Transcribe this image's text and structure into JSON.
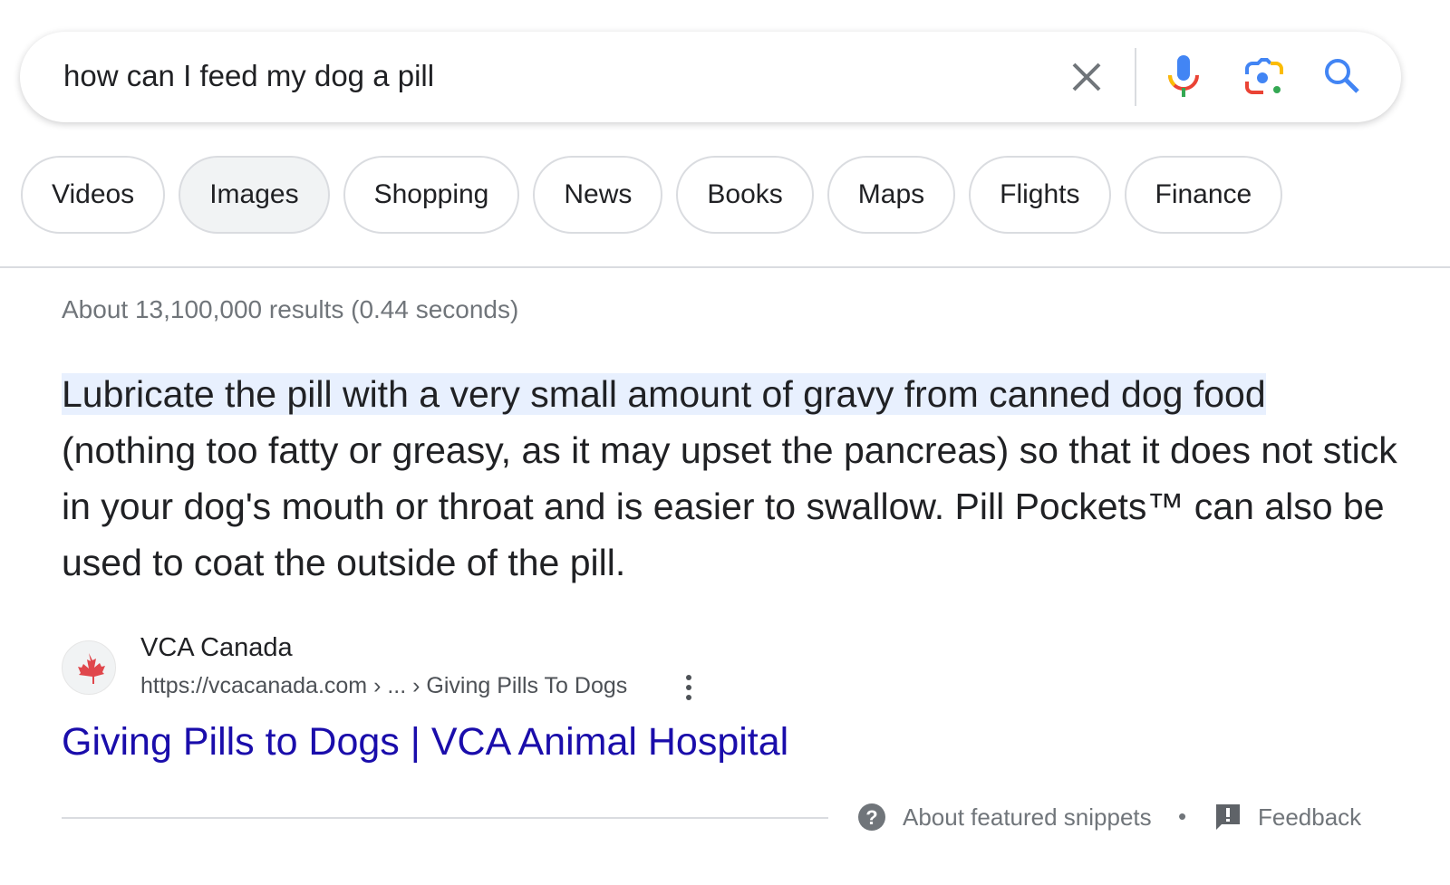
{
  "search": {
    "query": "how can I feed my dog a pill",
    "icons": [
      "close-icon",
      "microphone-icon",
      "lens-camera-icon",
      "search-icon"
    ]
  },
  "chips": [
    {
      "label": "Videos"
    },
    {
      "label": "Images",
      "active": true
    },
    {
      "label": "Shopping"
    },
    {
      "label": "News"
    },
    {
      "label": "Books"
    },
    {
      "label": "Maps"
    },
    {
      "label": "Flights"
    },
    {
      "label": "Finance"
    }
  ],
  "stats": "About 13,100,000 results (0.44 seconds)",
  "snippet": {
    "highlight": "Lubricate the pill with a very small amount of gravy from canned dog food",
    "rest": " (nothing too fatty or greasy, as it may upset the pancreas) so that it does not stick in your dog's mouth or throat and is easier to swallow. Pill Pockets™ can also be used to coat the outside of the pill."
  },
  "source": {
    "site": "VCA Canada",
    "url": "https://vcacanada.com › ... › Giving Pills To Dogs",
    "title": "Giving Pills to Dogs | VCA Animal Hospital",
    "favicon": "maple-leaf-icon"
  },
  "footer": {
    "about": "About featured snippets",
    "dot": "•",
    "feedback": "Feedback"
  },
  "colors": {
    "link": "#1a0dab",
    "highlight": "#e8f0fe",
    "blue": "#4285f4",
    "red": "#ea4335",
    "yellow": "#fbbc04",
    "green": "#34a853"
  }
}
